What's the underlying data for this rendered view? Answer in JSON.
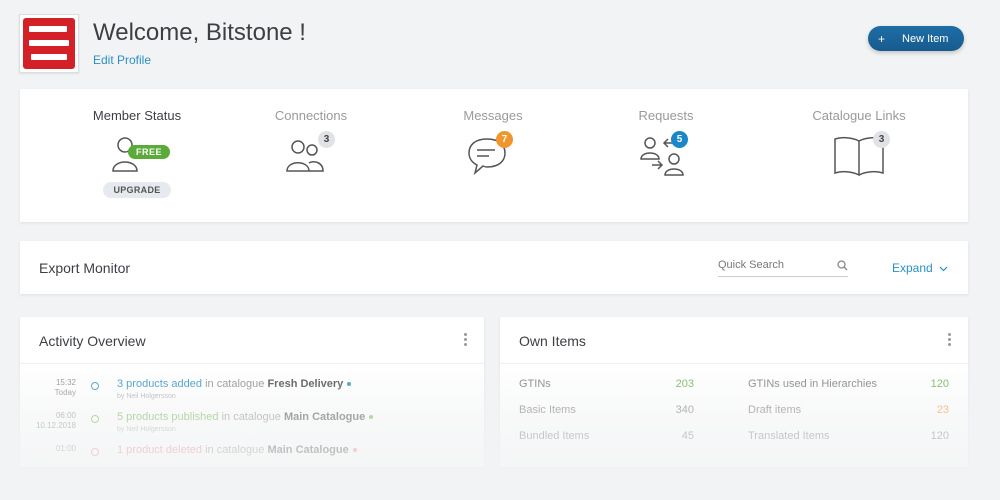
{
  "header": {
    "title": "Welcome, Bitstone !",
    "edit_profile": "Edit Profile",
    "new_item_plus": "+",
    "new_item_label": "New Item"
  },
  "status": {
    "items": [
      {
        "label": "Member Status",
        "badge": "FREE",
        "action": "UPGRADE"
      },
      {
        "label": "Connections",
        "badge": "3"
      },
      {
        "label": "Messages",
        "badge": "7"
      },
      {
        "label": "Requests",
        "badge": "5"
      },
      {
        "label": "Catalogue Links",
        "badge": "3"
      }
    ]
  },
  "export": {
    "title": "Export Monitor",
    "search_placeholder": "Quick Search",
    "expand": "Expand"
  },
  "activity": {
    "title": "Activity Overview",
    "entries": [
      {
        "time": "15:32",
        "day": "Today",
        "count": "3 products added",
        "mid": " in catalogue ",
        "catalogue": "Fresh Delivery",
        "by": "by Neil Holgersson"
      },
      {
        "time": "06:00",
        "day": "10.12.2018",
        "count": "5 products published",
        "mid": " in catalogue ",
        "catalogue": "Main Catalogue",
        "by": "by Neil Holgersson"
      },
      {
        "time": "01:00",
        "day": "",
        "count": "1 product deleted",
        "mid": " in catalogue ",
        "catalogue": "Main Catalogue",
        "by": ""
      }
    ]
  },
  "own": {
    "title": "Own Items",
    "left": [
      {
        "label": "GTINs",
        "value": "203"
      },
      {
        "label": "Basic Items",
        "value": "340"
      },
      {
        "label": "Bundled Items",
        "value": "45"
      }
    ],
    "right": [
      {
        "label": "GTINs used in Hierarchies",
        "value": "120"
      },
      {
        "label": "Draft items",
        "value": "23"
      },
      {
        "label": "Translated Items",
        "value": "120"
      }
    ]
  },
  "colors": {
    "accent_blue": "#2b8fc6",
    "green": "#6bb04a",
    "orange": "#f0962d",
    "brand_red": "#d42127"
  }
}
